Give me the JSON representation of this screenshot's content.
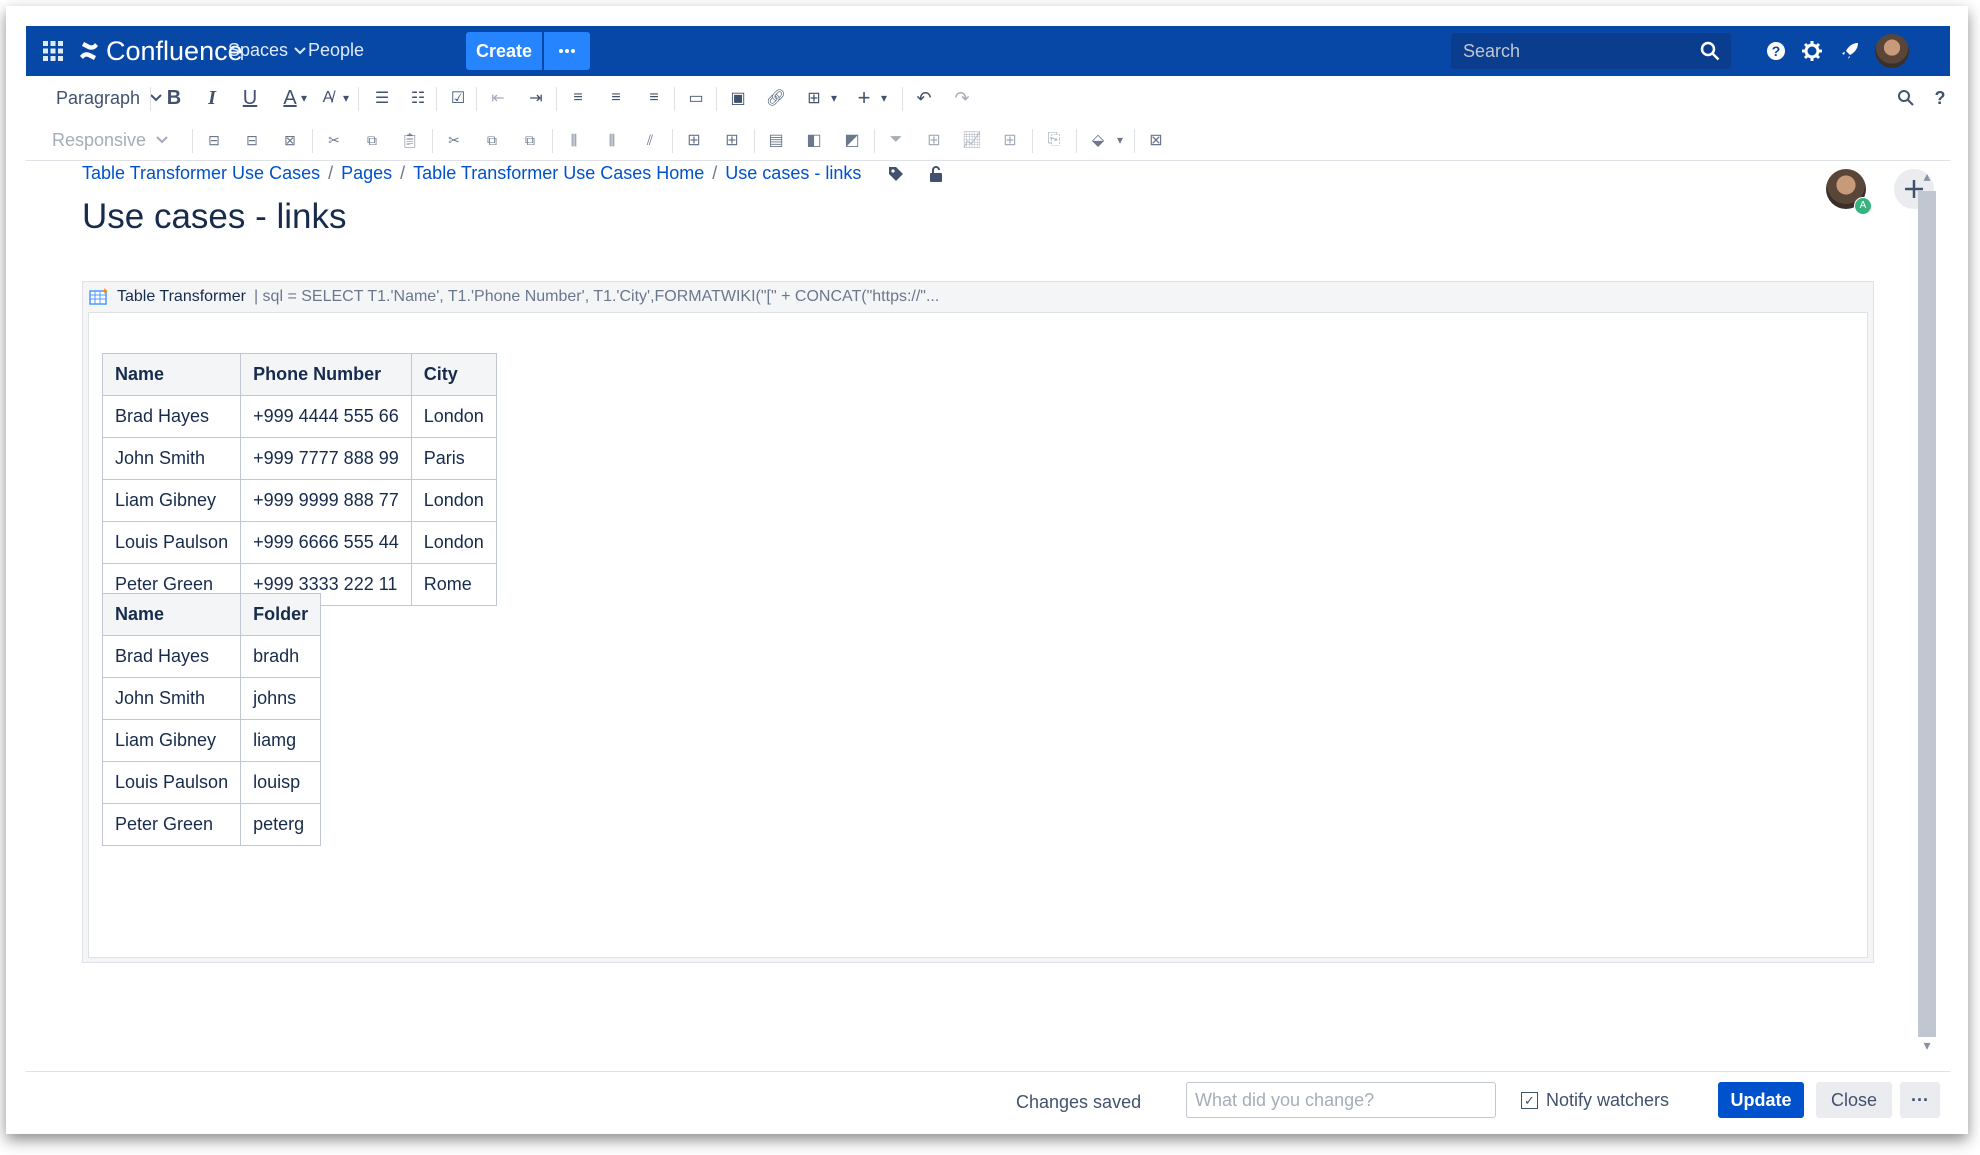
{
  "topnav": {
    "logo_text": "Confluence",
    "spaces": "Spaces",
    "people": "People",
    "create": "Create",
    "search_placeholder": "Search",
    "brand_color": "#0747a6",
    "accent_color": "#2684ff"
  },
  "toolbar": {
    "paragraph": "Paragraph",
    "responsive": "Responsive"
  },
  "breadcrumbs": [
    "Table Transformer Use Cases",
    "Pages",
    "Table Transformer Use Cases Home",
    "Use cases - links"
  ],
  "page_title": "Use cases - links",
  "collab_badge": "A",
  "macro": {
    "name": "Table Transformer",
    "params": "| sql = SELECT T1.'Name', T1.'Phone Number', T1.'City',FORMATWIKI(\"[\" + CONCAT(\"https://\"..."
  },
  "table1": {
    "headers": [
      "Name",
      "Phone Number",
      "City"
    ],
    "rows": [
      [
        "Brad Hayes",
        "+999 4444 555 66",
        "London"
      ],
      [
        "John Smith",
        "+999 7777 888 99",
        "Paris"
      ],
      [
        "Liam Gibney",
        "+999 9999 888 77",
        "London"
      ],
      [
        "Louis Paulson",
        "+999 6666 555 44",
        "London"
      ],
      [
        "Peter Green",
        "+999 3333 222 11",
        "Rome"
      ]
    ]
  },
  "table2": {
    "headers": [
      "Name",
      "Folder"
    ],
    "rows": [
      [
        "Brad Hayes",
        "bradh"
      ],
      [
        "John Smith",
        "johns"
      ],
      [
        "Liam Gibney",
        "liamg"
      ],
      [
        "Louis Paulson",
        "louisp"
      ],
      [
        "Peter Green",
        "peterg"
      ]
    ]
  },
  "footer": {
    "status": "Changes saved",
    "change_placeholder": "What did you change?",
    "notify_label": "Notify watchers",
    "notify_checked": true,
    "update": "Update",
    "close": "Close",
    "more": "···"
  }
}
